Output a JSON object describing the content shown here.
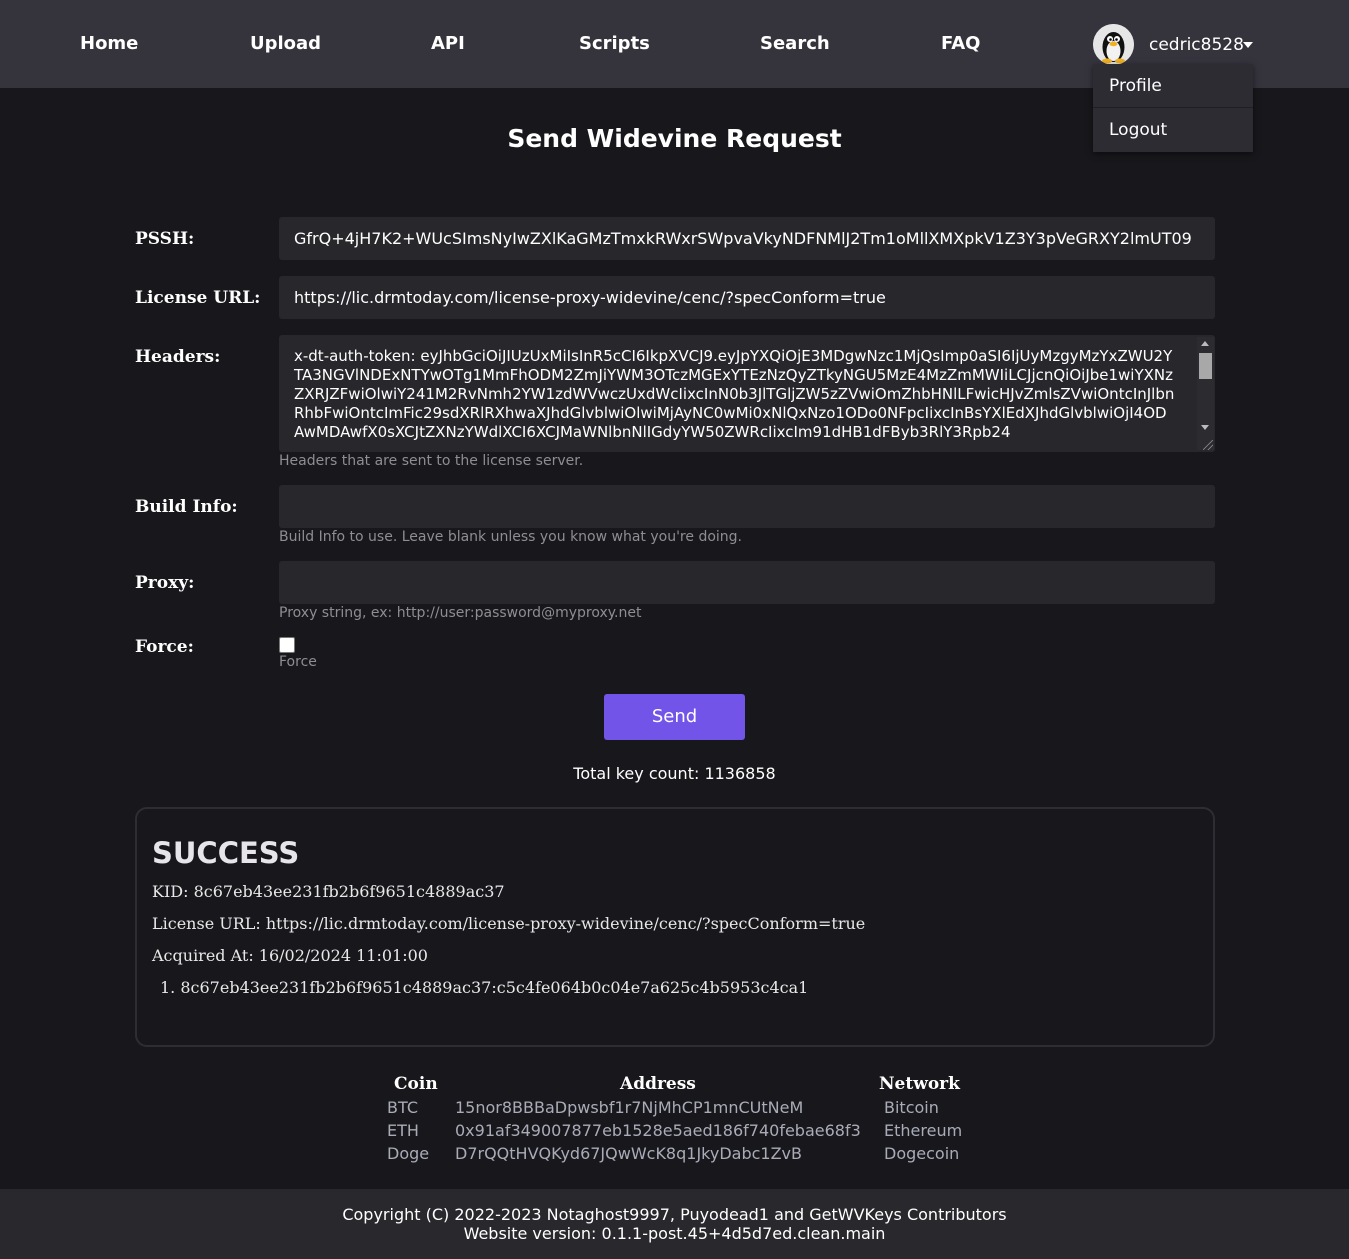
{
  "nav": {
    "home": "Home",
    "upload": "Upload",
    "api": "API",
    "scripts": "Scripts",
    "search": "Search",
    "faq": "FAQ",
    "username": "cedric8528",
    "dropdown": {
      "profile": "Profile",
      "logout": "Logout"
    }
  },
  "page": {
    "title": "Send Widevine Request"
  },
  "form": {
    "pssh_label": "PSSH:",
    "pssh_value": "GfrQ+4jH7K2+WUcSImsNyIwZXlKaGMzTmxkRWxrSWpvaVkyNDFNMlJ2Tm1oMllXMXpkV1Z3Y3pVeGRXY2lmUT09",
    "license_label": "License URL:",
    "license_value": "https://lic.drmtoday.com/license-proxy-widevine/cenc/?specConform=true",
    "headers_label": "Headers:",
    "headers_value": "x-dt-auth-token: eyJhbGciOiJIUzUxMiIsInR5cCI6IkpXVCJ9.eyJpYXQiOjE3MDgwNzc1MjQsImp0aSI6IjUyMzgyMzYxZWU2YTA3NGVlNDExNTYwOTg1MmFhODM2ZmJiYWM3OTczMGExYTEzNzQyZTkyNGU5MzE4MzZmMWIiLCJjcnQiOiJbe1wiYXNzZXRJZFwiOlwiY241M2RvNmh2YW1zdWVwczUxdWcIixcInN0b3JlTGljZW5zZVwiOmZhbHNlLFwicHJvZmlsZVwiOntcInJlbnRhbFwiOntcImFic29sdXRlRXhwaXJhdGlvblwiOlwiMjAyNC0wMi0xNlQxNzo1ODo0NFpcIixcInBsYXlEdXJhdGlvblwiOjI4ODAwMDAwfX0sXCJtZXNzYWdlXCI6XCJMaWNlbnNlIGdyYW50ZWRcIixcIm91dHB1dFByb3RlY3Rpb24",
    "headers_help": "Headers that are sent to the license server.",
    "build_label": "Build Info:",
    "build_value": "",
    "build_help": "Build Info to use. Leave blank unless you know what you're doing.",
    "proxy_label": "Proxy:",
    "proxy_value": "",
    "proxy_help": "Proxy string, ex: http://user:password@myproxy.net",
    "force_label": "Force:",
    "force_help": "Force",
    "send_label": "Send",
    "key_count": "Total key count: 1136858"
  },
  "result": {
    "title": "SUCCESS",
    "kid": "KID: 8c67eb43ee231fb2b6f9651c4889ac37",
    "license_url": "License URL: https://lic.drmtoday.com/license-proxy-widevine/cenc/?specConform=true",
    "acquired": "Acquired At: 16/02/2024 11:01:00",
    "keys": [
      "1. 8c67eb43ee231fb2b6f9651c4889ac37:c5c4fe064b0c04e7a625c4b5953c4ca1"
    ]
  },
  "donations": {
    "headers": [
      "Coin",
      "Address",
      "Network"
    ],
    "rows": [
      [
        "BTC",
        "15nor8BBBaDpwsbf1r7NjMhCP1mnCUtNeM",
        "Bitcoin"
      ],
      [
        "ETH",
        "0x91af349007877eb1528e5aed186f740febae68f3",
        "Ethereum"
      ],
      [
        "Doge",
        "D7rQQtHVQKyd67JQwWcK8q1JkyDabc1ZvB",
        "Dogecoin"
      ]
    ]
  },
  "footer": {
    "copyright": "Copyright (C) 2022-2023 Notaghost9997, Puyodead1 and GetWVKeys Contributors",
    "version": "Website version: 0.1.1-post.45+4d5d7ed.clean.main"
  },
  "colors": {
    "accent": "#7254e9",
    "navbar": "#35333c",
    "background": "#18181c"
  },
  "icons": {
    "avatar": "tux-penguin-avatar",
    "caret": "caret-down-icon"
  }
}
